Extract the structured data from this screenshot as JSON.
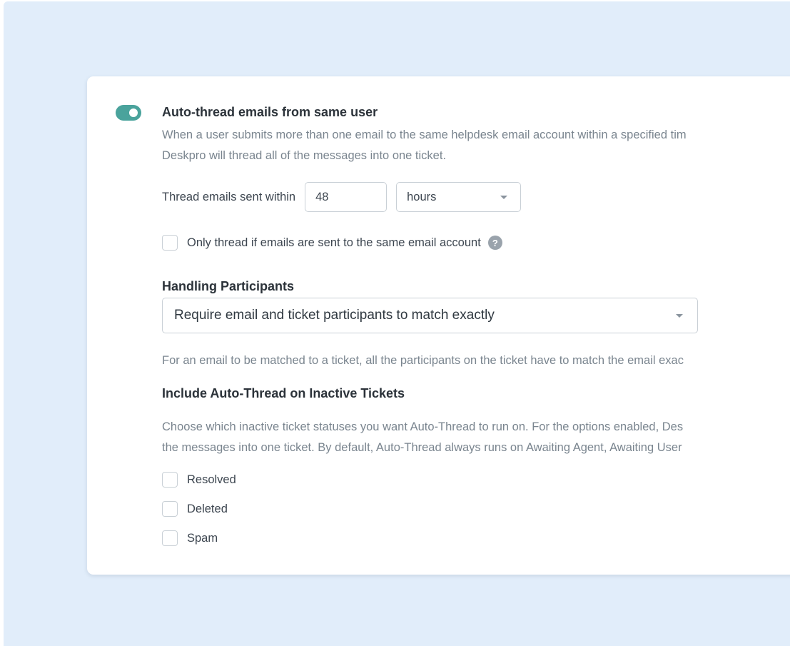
{
  "auto_thread": {
    "enabled": true,
    "title": "Auto-thread emails from same user",
    "description_line1": "When a user submits more than one email to the same helpdesk email account within a specified tim",
    "description_line2": "Deskpro will thread all of the messages into one ticket.",
    "thread_within_label": "Thread emails sent within",
    "thread_within_value": "48",
    "thread_within_unit": "hours",
    "same_account_label": "Only thread if emails are sent to the same email account",
    "same_account_checked": false,
    "help_icon_glyph": "?"
  },
  "participants": {
    "title": "Handling Participants",
    "selected": "Require email and ticket participants to match exactly",
    "description": "For an email to be matched to a ticket, all the participants on the ticket have to match the email exac"
  },
  "inactive": {
    "title": "Include Auto-Thread on Inactive Tickets",
    "description_line1": "Choose which inactive ticket statuses you want Auto-Thread to run on. For the options enabled, Des",
    "description_line2": "the messages into one ticket. By default, Auto-Thread always runs on Awaiting Agent, Awaiting User",
    "statuses": [
      {
        "label": "Resolved",
        "checked": false
      },
      {
        "label": "Deleted",
        "checked": false
      },
      {
        "label": "Spam",
        "checked": false
      }
    ]
  },
  "colors": {
    "background": "#e1edfa",
    "toggle_on": "#4aa39c",
    "text_primary": "#2b3239",
    "text_muted": "#7a858f"
  }
}
